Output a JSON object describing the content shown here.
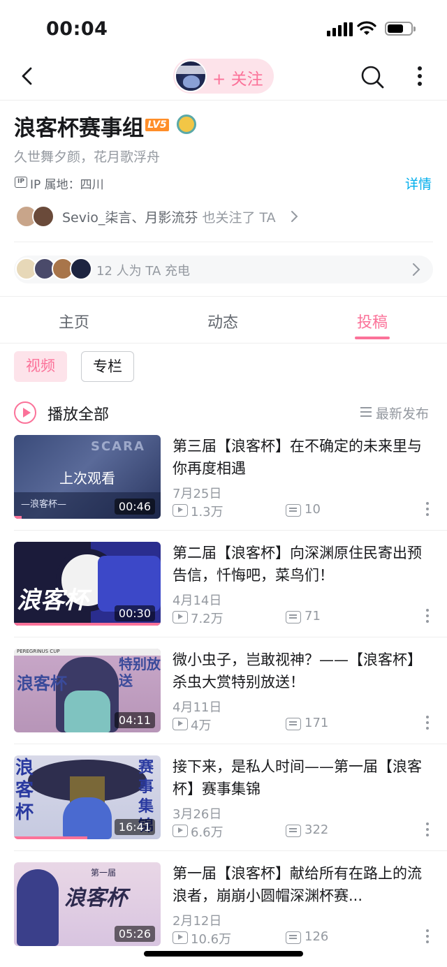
{
  "status_bar": {
    "time": "00:04"
  },
  "nav": {
    "follow_label": "+ 关注"
  },
  "profile": {
    "name": "浪客杯赛事组",
    "level": "LV5",
    "sign": "久世舞夕颜，花月歌浮舟",
    "ip": "IP 属地：四川",
    "ip_badge": "IP",
    "detail_link": "详情",
    "mutual_names": "Sevio_柒言、月影流芬",
    "mutual_suffix": " 也关注了 TA",
    "charge_text": "12 人为 TA 充电"
  },
  "tabs": [
    {
      "label": "主页",
      "active": false
    },
    {
      "label": "动态",
      "active": false
    },
    {
      "label": "投稿",
      "active": true
    }
  ],
  "chips": {
    "video": "视频",
    "column": "专栏"
  },
  "list_header": {
    "play_all": "播放全部",
    "sort": "最新发布"
  },
  "videos": [
    {
      "title": "第三届【浪客杯】在不确定的未来里与你再度相遇",
      "date": "7月25日",
      "views": "1.3万",
      "danmaku": "10",
      "duration": "00:46",
      "last_watched": "上次观看",
      "progress": 0.05,
      "thumb_text": "SCARA",
      "thumb_sub": "—浪客杯—"
    },
    {
      "title": "第二届【浪客杯】向深渊原住民寄出预告信，忏悔吧，菜鸟们！",
      "date": "4月14日",
      "views": "7.2万",
      "danmaku": "71",
      "duration": "00:30",
      "progress": 1.0,
      "thumb_text": "浪客杯"
    },
    {
      "title": "微小虫子，岂敢视神？——【浪客杯】杀虫大赏特别放送！",
      "date": "4月11日",
      "views": "4万",
      "danmaku": "171",
      "duration": "04:11",
      "progress": 0,
      "thumb_text": "浪客杯",
      "thumb_sub": "特别放送",
      "thumb_top": "PEREGRINUS CUP"
    },
    {
      "title": "接下来，是私人时间——第一届【浪客杯】赛事集锦",
      "date": "3月26日",
      "views": "6.6万",
      "danmaku": "322",
      "duration": "16:41",
      "progress": 0.5,
      "thumb_text": "浪客杯",
      "thumb_sub": "赛事集锦"
    },
    {
      "title": "第一届【浪客杯】献给所有在路上的流浪者，崩崩小圆帽深渊杯赛...",
      "date": "2月12日",
      "views": "10.6万",
      "danmaku": "126",
      "duration": "05:26",
      "progress": 0,
      "thumb_text": "浪客杯",
      "thumb_sub": "第一届"
    }
  ],
  "colors": {
    "accent": "#fb7299",
    "link": "#00aeec",
    "muted": "#9499a0"
  }
}
